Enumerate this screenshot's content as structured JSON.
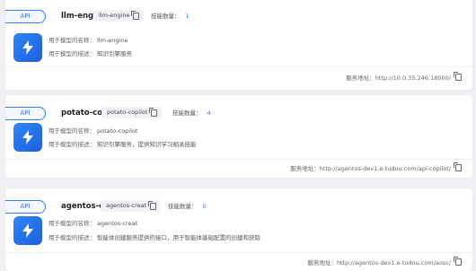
{
  "services": [
    {
      "tag": "API",
      "name": "llm-engine",
      "chip": "llm-engine",
      "skills_label": "技能数量：",
      "skills_count": "1",
      "model_name_label": "用于模型的名称：",
      "model_name": "llm-engine",
      "model_desc_label": "用于模型的描述：",
      "model_desc": "知识引擎服务",
      "address_label": "服务地址：",
      "address": "http://10.0.35.246:18000/"
    },
    {
      "tag": "API",
      "name": "potato-copilot",
      "chip": "potato-copilot",
      "skills_label": "技能数量：",
      "skills_count": "4",
      "model_name_label": "用于模型的名称：",
      "model_name": "potato-copilot",
      "model_desc_label": "用于模型的描述：",
      "model_desc": "知识引擎服务，提供知识学习相关技能",
      "address_label": "服务地址：",
      "address": "http://agentos-dev1.e-tudou.com/api-copilot/"
    },
    {
      "tag": "API",
      "name": "agentos-creat",
      "chip": "agentos-creat",
      "skills_label": "技能数量：",
      "skills_count": "0",
      "model_name_label": "用于模型的名称：",
      "model_name": "agentos-creat",
      "model_desc_label": "用于模型的描述：",
      "model_desc": "智能体创建服务提供的接口，用于智能体基础配置的创建和获取",
      "address_label": "服务地址：",
      "address": "http://agentos-dev1.e-tudou.com/aosc/"
    }
  ],
  "icons": {
    "app": "lightning-icon",
    "copy": "copy-icon"
  },
  "colors": {
    "accent": "#2f6fe8",
    "icon_bg": "#1e5fe0"
  }
}
